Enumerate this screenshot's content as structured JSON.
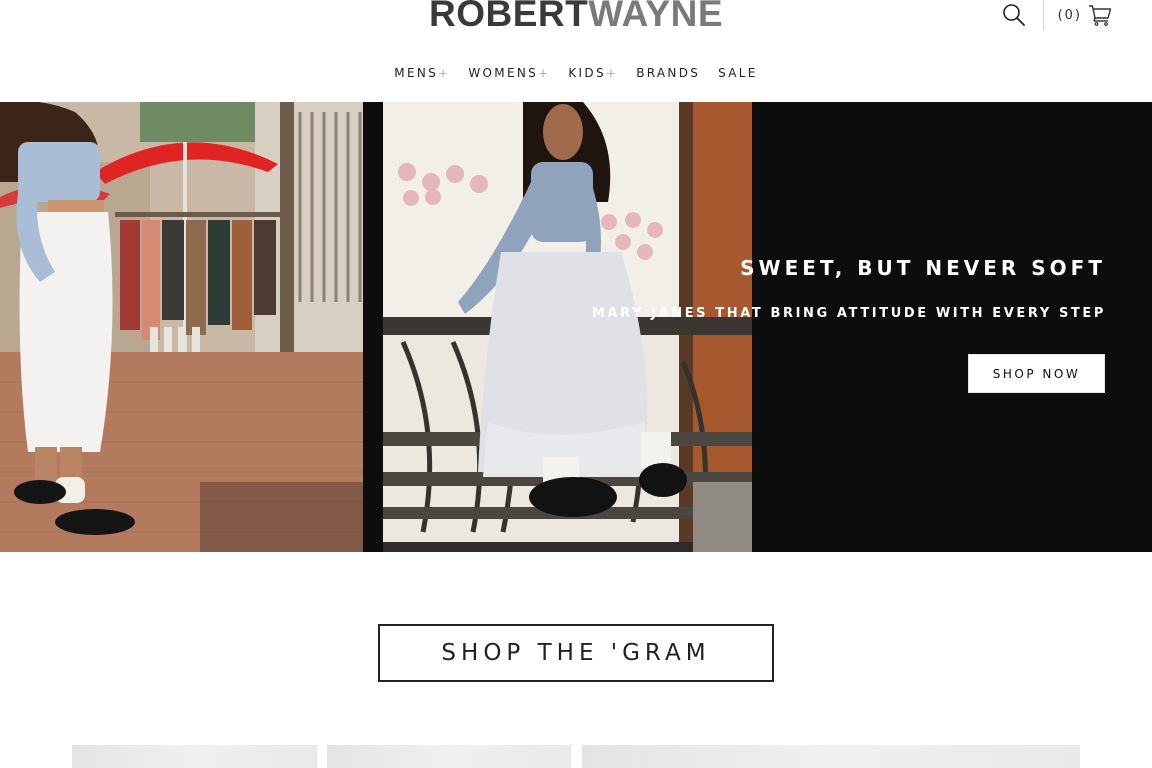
{
  "header": {
    "logo_part1": "ROBERT",
    "logo_part2": "WAYNE",
    "search_icon": "search-icon",
    "cart_count": "(0)",
    "cart_icon": "cart-icon"
  },
  "nav": {
    "items": [
      {
        "label": "MENS",
        "has_submenu": true,
        "plus": "+"
      },
      {
        "label": "WOMENS",
        "has_submenu": true,
        "plus": "+"
      },
      {
        "label": "KIDS",
        "has_submenu": true,
        "plus": "+"
      },
      {
        "label": "BRANDS",
        "has_submenu": false
      },
      {
        "label": "SALE",
        "has_submenu": false
      }
    ]
  },
  "hero": {
    "title": "SWEET, BUT NEVER SOFT",
    "subtitle": "MARY JANES THAT BRING ATTITUDE WITH EVERY STEP",
    "cta_label": "SHOP NOW",
    "background_color": "#0d0d0d"
  },
  "gram": {
    "label": "SHOP THE 'GRAM"
  },
  "colors": {
    "accent": "#222222",
    "umbrella_red": "#e02424"
  }
}
